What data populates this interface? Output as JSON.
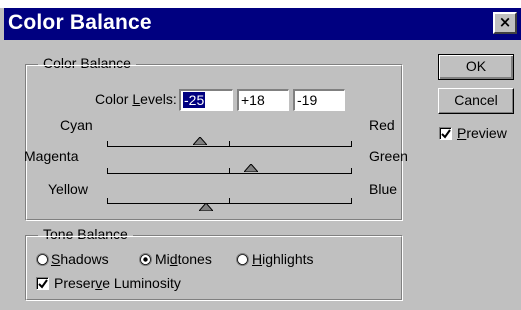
{
  "window": {
    "title": "Color Balance",
    "close_glyph": "×"
  },
  "color_balance": {
    "group_label": "Color Balance",
    "levels_label_pre": "Color ",
    "levels_label_ul": "L",
    "levels_label_post": "evels:",
    "levels": [
      "-25",
      "+18",
      "-19"
    ],
    "sliders": [
      {
        "left": "Cyan",
        "right": "Red",
        "value": -25
      },
      {
        "left": "Magenta",
        "right": "Green",
        "value": 18
      },
      {
        "left": "Yellow",
        "right": "Blue",
        "value": -19
      }
    ],
    "slider_range": [
      -100,
      100
    ]
  },
  "tone_balance": {
    "group_label": "Tone Balance",
    "options": [
      {
        "pre": "",
        "ul": "S",
        "post": "hadows",
        "selected": false
      },
      {
        "pre": "Mi",
        "ul": "d",
        "post": "tones",
        "selected": true
      },
      {
        "pre": "",
        "ul": "H",
        "post": "ighlights",
        "selected": false
      }
    ],
    "preserve_pre": "Preser",
    "preserve_ul": "v",
    "preserve_post": "e Luminosity",
    "preserve_checked": true
  },
  "buttons": {
    "ok": "OK",
    "cancel": "Cancel"
  },
  "preview": {
    "ul": "P",
    "post": "review",
    "checked": true
  }
}
